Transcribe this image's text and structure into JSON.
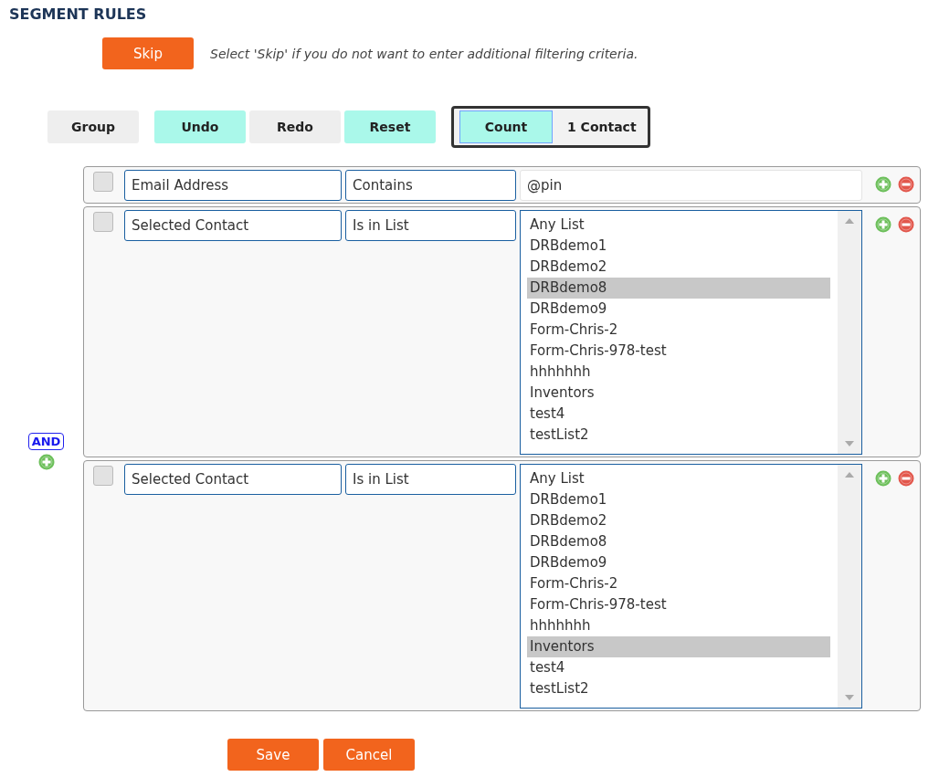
{
  "title": "SEGMENT RULES",
  "skip": {
    "button": "Skip",
    "hint": "Select 'Skip' if you do not want to enter additional filtering criteria."
  },
  "toolbar": [
    {
      "label": "Group",
      "highlighted": false
    },
    {
      "label": "Undo",
      "highlighted": true
    },
    {
      "label": "Redo",
      "highlighted": false
    },
    {
      "label": "Reset",
      "highlighted": true
    }
  ],
  "count": {
    "button": "Count",
    "result": "1 Contact"
  },
  "group": {
    "operator": "AND",
    "rules": [
      {
        "kind": "text",
        "checked": false,
        "field": "Email Address",
        "operator": "Contains",
        "value": "@pin"
      },
      {
        "kind": "list",
        "checked": false,
        "field": "Selected Contact",
        "operator": "Is in List",
        "options": [
          {
            "label": "Any List",
            "selected": false
          },
          {
            "label": "DRBdemo1",
            "selected": false
          },
          {
            "label": "DRBdemo2",
            "selected": false
          },
          {
            "label": "DRBdemo8",
            "selected": true
          },
          {
            "label": "DRBdemo9",
            "selected": false
          },
          {
            "label": "Form-Chris-2",
            "selected": false
          },
          {
            "label": "Form-Chris-978-test",
            "selected": false
          },
          {
            "label": "hhhhhhh",
            "selected": false
          },
          {
            "label": "Inventors",
            "selected": false
          },
          {
            "label": "test4",
            "selected": false
          },
          {
            "label": "testList2",
            "selected": false
          }
        ]
      },
      {
        "kind": "list",
        "checked": false,
        "field": "Selected Contact",
        "operator": "Is in List",
        "options": [
          {
            "label": "Any List",
            "selected": false
          },
          {
            "label": "DRBdemo1",
            "selected": false
          },
          {
            "label": "DRBdemo2",
            "selected": false
          },
          {
            "label": "DRBdemo8",
            "selected": false
          },
          {
            "label": "DRBdemo9",
            "selected": false
          },
          {
            "label": "Form-Chris-2",
            "selected": false
          },
          {
            "label": "Form-Chris-978-test",
            "selected": false
          },
          {
            "label": "hhhhhhh",
            "selected": false
          },
          {
            "label": "Inventors",
            "selected": true
          },
          {
            "label": "test4",
            "selected": false
          },
          {
            "label": "testList2",
            "selected": false
          }
        ]
      }
    ]
  },
  "actions": [
    "Save",
    "Cancel"
  ]
}
